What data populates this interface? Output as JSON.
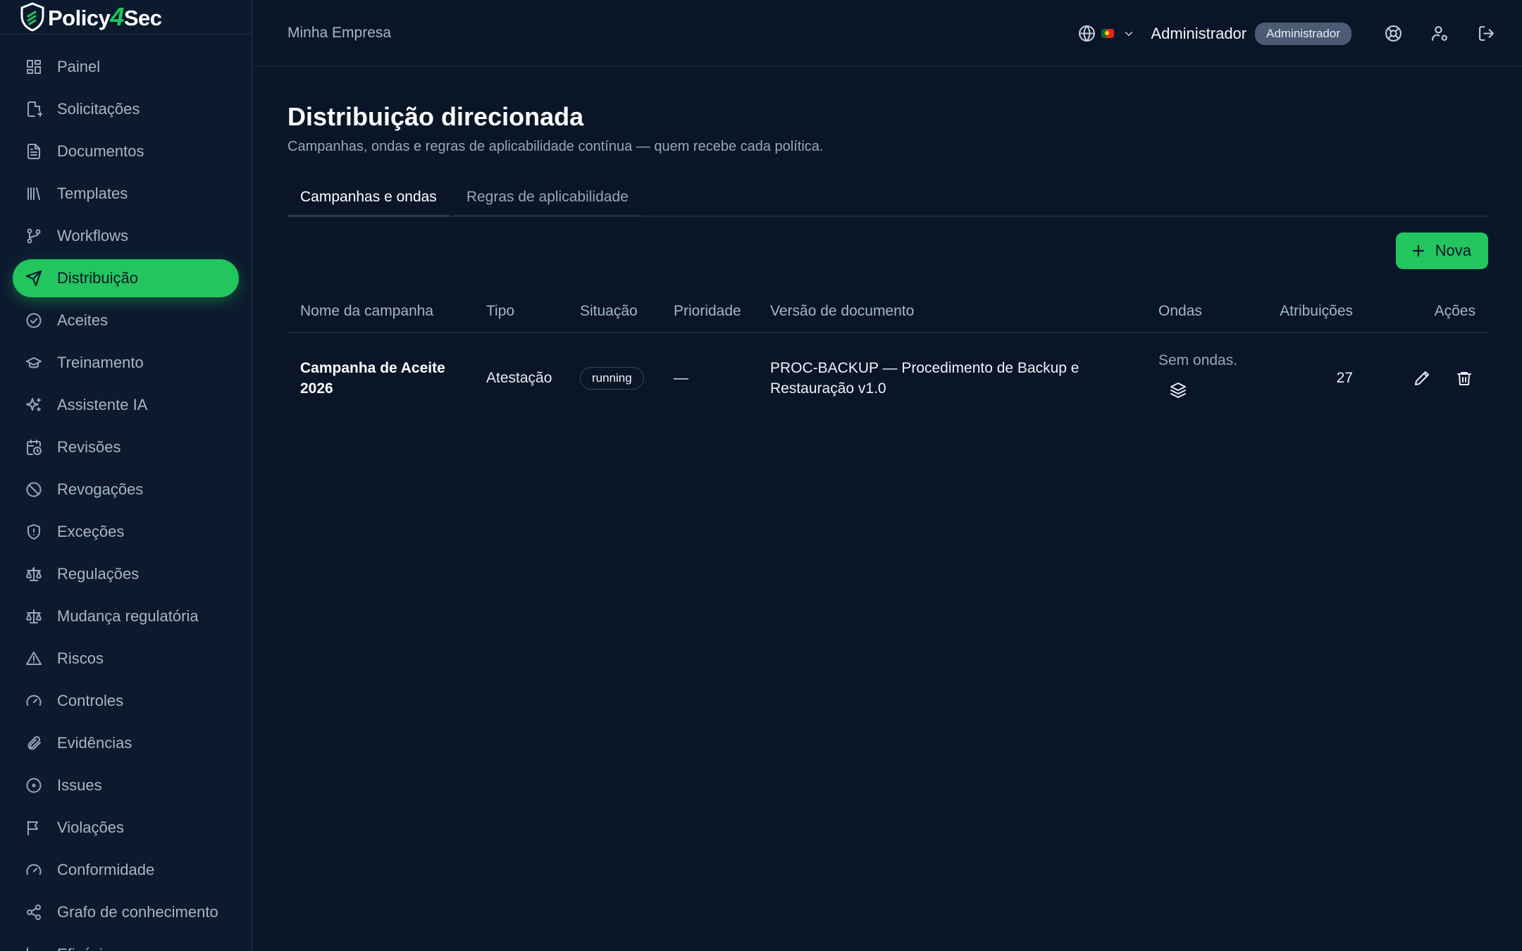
{
  "app": {
    "brand_main": "Policy",
    "brand_four": "4",
    "brand_suffix": "Sec",
    "logo_icon": "shield-icon"
  },
  "sidebar": {
    "items": [
      {
        "label": "Painel",
        "icon": "dashboard-icon"
      },
      {
        "label": "Solicitações",
        "icon": "file-plus-icon"
      },
      {
        "label": "Documentos",
        "icon": "document-icon"
      },
      {
        "label": "Templates",
        "icon": "library-icon"
      },
      {
        "label": "Workflows",
        "icon": "git-branch-icon"
      },
      {
        "label": "Distribuição",
        "icon": "send-icon",
        "active": true
      },
      {
        "label": "Aceites",
        "icon": "check-circle-icon"
      },
      {
        "label": "Treinamento",
        "icon": "graduation-cap-icon"
      },
      {
        "label": "Assistente IA",
        "icon": "sparkles-icon"
      },
      {
        "label": "Revisões",
        "icon": "calendar-clock-icon"
      },
      {
        "label": "Revogações",
        "icon": "ban-icon"
      },
      {
        "label": "Exceções",
        "icon": "shield-alert-icon"
      },
      {
        "label": "Regulações",
        "icon": "scale-icon"
      },
      {
        "label": "Mudança regulatória",
        "icon": "scale-icon"
      },
      {
        "label": "Riscos",
        "icon": "warning-triangle-icon"
      },
      {
        "label": "Controles",
        "icon": "gauge-icon"
      },
      {
        "label": "Evidências",
        "icon": "paperclip-icon"
      },
      {
        "label": "Issues",
        "icon": "circle-dot-icon"
      },
      {
        "label": "Violações",
        "icon": "flag-icon"
      },
      {
        "label": "Conformidade",
        "icon": "gauge-icon"
      },
      {
        "label": "Grafo de conhecimento",
        "icon": "share-icon"
      },
      {
        "label": "Eficácia",
        "icon": "chart-icon"
      }
    ]
  },
  "header": {
    "org_name": "Minha Empresa",
    "user_name": "Administrador",
    "role_badge": "Administrador"
  },
  "main": {
    "title": "Distribuição direcionada",
    "subtitle": "Campanhas, ondas e regras de aplicabilidade contínua — quem recebe cada política.",
    "tabs": [
      {
        "label": "Campanhas e ondas",
        "active": true
      },
      {
        "label": "Regras de aplicabilidade",
        "active": false
      }
    ],
    "new_button": "Nova",
    "table": {
      "headers": [
        "Nome da campanha",
        "Tipo",
        "Situação",
        "Prioridade",
        "Versão de documento",
        "Ondas",
        "Atribuições",
        "Ações"
      ],
      "rows": [
        {
          "name": "Campanha de Aceite 2026",
          "type": "Atestação",
          "status": "running",
          "priority": "—",
          "doc_version": "PROC-BACKUP — Procedimento de Backup e Restauração v1.0",
          "waves": "Sem ondas.",
          "assignments": "27"
        }
      ]
    }
  },
  "colors": {
    "background": "#0a1628",
    "accent": "#22c55e",
    "badge": "#4b5b74"
  }
}
